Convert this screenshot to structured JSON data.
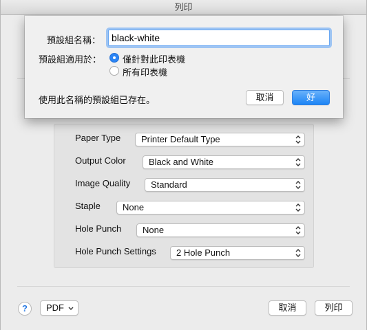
{
  "window": {
    "title": "列印"
  },
  "options": [
    {
      "label": "Paper Type",
      "value": "Printer Default Type"
    },
    {
      "label": "Output Color",
      "value": "Black and White"
    },
    {
      "label": "Image Quality",
      "value": "Standard"
    },
    {
      "label": "Staple",
      "value": "None"
    },
    {
      "label": "Hole Punch",
      "value": "None"
    },
    {
      "label": "Hole Punch Settings",
      "value": "2 Hole Punch"
    }
  ],
  "bottom": {
    "help": "?",
    "pdf_label": "PDF",
    "cancel_label": "取消",
    "print_label": "列印"
  },
  "sheet": {
    "name_label": "預設組名稱：",
    "name_value": "black-white",
    "apply_label": "預設組適用於：",
    "radio_this": "僅針對此印表機",
    "radio_all": "所有印表機",
    "message": "使用此名稱的預設組已存在。",
    "cancel_label": "取消",
    "ok_label": "好"
  },
  "colors": {
    "accent": "#1c84f5",
    "focus_ring": "#6aa8f2"
  }
}
